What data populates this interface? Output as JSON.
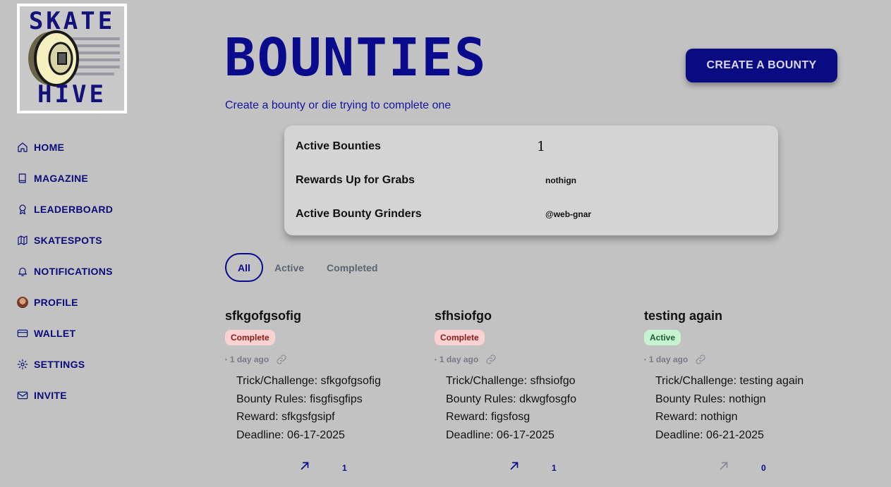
{
  "logo": {
    "top_word": "SKATE",
    "bottom_word": "HIVE"
  },
  "nav": [
    {
      "label": "HOME",
      "icon": "home-icon"
    },
    {
      "label": "MAGAZINE",
      "icon": "book-icon"
    },
    {
      "label": "LEADERBOARD",
      "icon": "award-icon"
    },
    {
      "label": "SKATESPOTS",
      "icon": "map-icon"
    },
    {
      "label": "NOTIFICATIONS",
      "icon": "bell-icon"
    },
    {
      "label": "PROFILE",
      "icon": "avatar-icon"
    },
    {
      "label": "WALLET",
      "icon": "credit-card-icon"
    },
    {
      "label": "SETTINGS",
      "icon": "gear-icon"
    },
    {
      "label": "INVITE",
      "icon": "mail-icon"
    }
  ],
  "header": {
    "title": "BOUNTIES",
    "subtitle": "Create a bounty or die trying to complete one",
    "create_button": "CREATE A BOUNTY"
  },
  "stats": [
    {
      "label": "Active Bounties",
      "value": "1"
    },
    {
      "label": "Rewards Up for Grabs",
      "value": "nothign"
    },
    {
      "label": "Active Bounty Grinders",
      "value": "@web-gnar"
    }
  ],
  "tabs": [
    "All",
    "Active",
    "Completed"
  ],
  "labels": {
    "trick": "Trick/Challenge: ",
    "rules": "Bounty Rules: ",
    "reward": "Reward: ",
    "deadline": "Deadline: "
  },
  "bounties": [
    {
      "title": "sfkgofgsofig",
      "status": "Complete",
      "status_type": "complete",
      "time": "1 day ago",
      "trick": "sfkgofgsofig",
      "rules": "fisgfisgfips",
      "reward": "sfkgsfgsipf",
      "deadline": "06-17-2025",
      "votes": "1",
      "voted": true
    },
    {
      "title": "sfhsiofgo",
      "status": "Complete",
      "status_type": "complete",
      "time": "1 day ago",
      "trick": "sfhsiofgo",
      "rules": "dkwgfosgfo",
      "reward": "figsfosg",
      "deadline": "06-17-2025",
      "votes": "1",
      "voted": true
    },
    {
      "title": "testing again",
      "status": "Active",
      "status_type": "active",
      "time": "1 day ago",
      "trick": "testing again",
      "rules": "nothign",
      "reward": "nothign",
      "deadline": "06-21-2025",
      "votes": "0",
      "voted": false
    }
  ],
  "colors": {
    "background": "#c2c2c2",
    "accent": "#0a0a8c"
  }
}
